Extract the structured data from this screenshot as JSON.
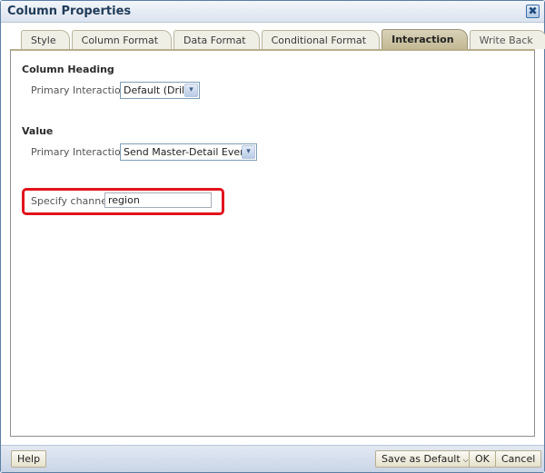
{
  "dialog": {
    "title": "Column Properties",
    "close_icon": "close-icon"
  },
  "tabs": [
    {
      "label": "Style",
      "active": false
    },
    {
      "label": "Column Format",
      "active": false
    },
    {
      "label": "Data Format",
      "active": false
    },
    {
      "label": "Conditional Format",
      "active": false
    },
    {
      "label": "Interaction",
      "active": true
    },
    {
      "label": "Write Back",
      "active": false
    }
  ],
  "column_heading": {
    "title": "Column Heading",
    "primary_interaction_label": "Primary Interaction",
    "primary_interaction_value": "Default (Drill)"
  },
  "value": {
    "title": "Value",
    "primary_interaction_label": "Primary Interaction",
    "primary_interaction_value": "Send Master-Detail Events",
    "channel_label": "Specify channel",
    "channel_value": "region"
  },
  "highlight_color": "#e2141c",
  "footer": {
    "help_label": "Help",
    "save_default_label": "Save as Default",
    "ok_label": "OK",
    "cancel_label": "Cancel"
  },
  "icons": {
    "dropdown_arrow": "▾",
    "close": "✖",
    "caret": "⌵"
  }
}
